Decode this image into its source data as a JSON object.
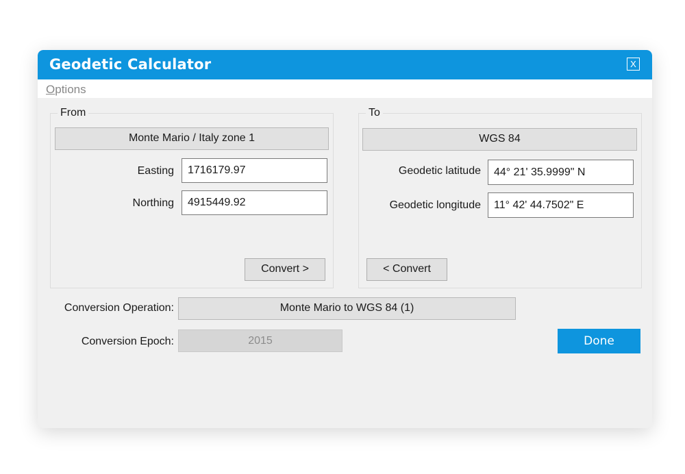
{
  "window": {
    "title": "Geodetic Calculator",
    "close_label": "X"
  },
  "menu": {
    "options_mnemonic": "O",
    "options_rest": "ptions"
  },
  "from": {
    "legend": "From",
    "crs": "Monte Mario / Italy zone 1",
    "easting_label": "Easting",
    "easting_value": "1716179.97",
    "northing_label": "Northing",
    "northing_value": "4915449.92",
    "convert_label": "Convert >"
  },
  "to": {
    "legend": "To",
    "crs": "WGS 84",
    "latitude_label": "Geodetic latitude",
    "latitude_value": "44° 21' 35.9999\" N",
    "longitude_label": "Geodetic longitude",
    "longitude_value": "11° 42' 44.7502\" E",
    "convert_label": "< Convert"
  },
  "conversion": {
    "operation_label": "Conversion Operation:",
    "operation_value": "Monte Mario to WGS 84 (1)",
    "epoch_label": "Conversion Epoch:",
    "epoch_value": "2015"
  },
  "footer": {
    "done_label": "Done"
  },
  "colors": {
    "accent": "#0e95de",
    "background": "#f0f0f0"
  }
}
